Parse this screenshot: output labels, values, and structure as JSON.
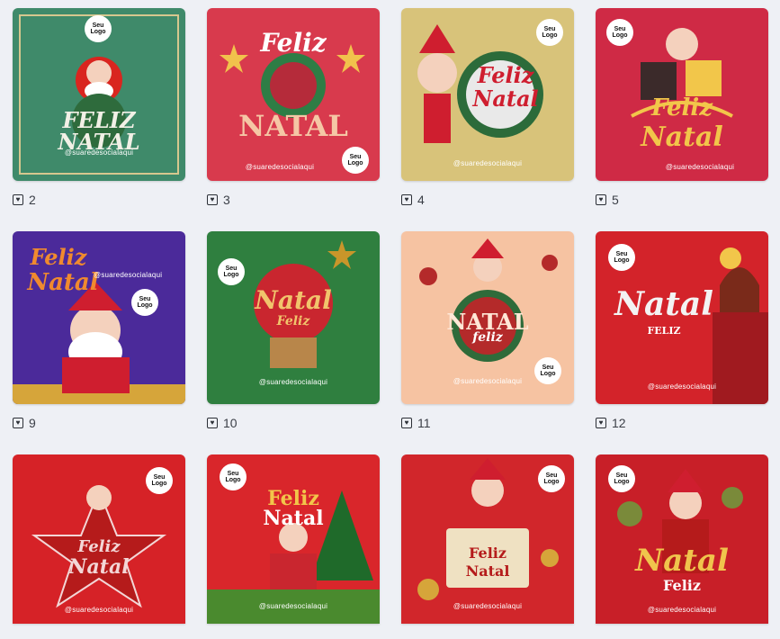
{
  "gallery": {
    "cards": [
      {
        "likes": "2",
        "greeting_top": "FELIZ",
        "greeting_bottom": "NATAL",
        "handle": "@suaredesocialaqui",
        "logo": [
          "Seu",
          "Logo"
        ],
        "colors": {
          "bg": "#3f8a6a",
          "accent": "#f2f0e6"
        }
      },
      {
        "likes": "3",
        "greeting_top": "Feliz",
        "greeting_bottom": "NATAL",
        "handle": "@suaredesocialaqui",
        "logo": [
          "Seu",
          "Logo"
        ],
        "colors": {
          "bg": "#d83a4d",
          "accent": "#f5c7a5"
        }
      },
      {
        "likes": "4",
        "greeting_top": "Feliz",
        "greeting_bottom": "Natal",
        "handle": "@suaredesocialaqui",
        "logo": [
          "Seu",
          "Logo"
        ],
        "colors": {
          "bg": "#d8c37a",
          "accent": "#cf1e2f"
        }
      },
      {
        "likes": "5",
        "greeting_top": "Feliz",
        "greeting_bottom": "Natal",
        "handle": "@suaredesocialaqui",
        "logo": [
          "Seu",
          "Logo"
        ],
        "colors": {
          "bg": "#cf2a45",
          "accent": "#f2c64a"
        }
      },
      {
        "likes": "9",
        "greeting_top": "Feliz",
        "greeting_bottom": "Natal",
        "handle": "@suaredesocialaqui",
        "logo": [
          "Seu",
          "Logo"
        ],
        "colors": {
          "bg": "#4b2a9a",
          "accent": "#f08a2e"
        }
      },
      {
        "likes": "10",
        "greeting_top": "Natal",
        "greeting_bottom": "Feliz",
        "handle": "@suaredesocialaqui",
        "logo": [
          "Seu",
          "Logo"
        ],
        "colors": {
          "bg": "#2f7f3f",
          "accent": "#f1c46c"
        }
      },
      {
        "likes": "11",
        "greeting_top": "NATAL",
        "greeting_bottom": "feliz",
        "handle": "@suaredesocialaqui",
        "logo": [
          "Seu",
          "Logo"
        ],
        "colors": {
          "bg": "#f6c3a2",
          "accent": "#b42a2a"
        }
      },
      {
        "likes": "12",
        "greeting_top": "Natal",
        "greeting_bottom": "FELIZ",
        "handle": "@suaredesocialaqui",
        "logo": [
          "Seu",
          "Logo"
        ],
        "colors": {
          "bg": "#d3232a",
          "accent": "#f3f3f3"
        }
      },
      {
        "likes": "",
        "greeting_top": "Feliz",
        "greeting_bottom": "Natal",
        "handle": "@suaredesocialaqui",
        "logo": [
          "Seu",
          "Logo"
        ],
        "colors": {
          "bg": "#d62227",
          "accent": "#f3d6d6"
        }
      },
      {
        "likes": "",
        "greeting_top": "Feliz",
        "greeting_bottom": "Natal",
        "handle": "@suaredesocialaqui",
        "logo": [
          "Seu",
          "Logo"
        ],
        "colors": {
          "bg": "#d9262b",
          "accent": "#ffffff"
        }
      },
      {
        "likes": "",
        "greeting_top": "Feliz",
        "greeting_bottom": "Natal",
        "handle": "@suaredesocialaqui",
        "logo": [
          "Seu",
          "Logo"
        ],
        "colors": {
          "bg": "#d1262b",
          "accent": "#b51b1b"
        }
      },
      {
        "likes": "",
        "greeting_top": "Natal",
        "greeting_bottom": "Feliz",
        "handle": "@suaredesocialaqui",
        "logo": [
          "Seu",
          "Logo"
        ],
        "colors": {
          "bg": "#c81f28",
          "accent": "#f0c44c"
        }
      }
    ]
  }
}
